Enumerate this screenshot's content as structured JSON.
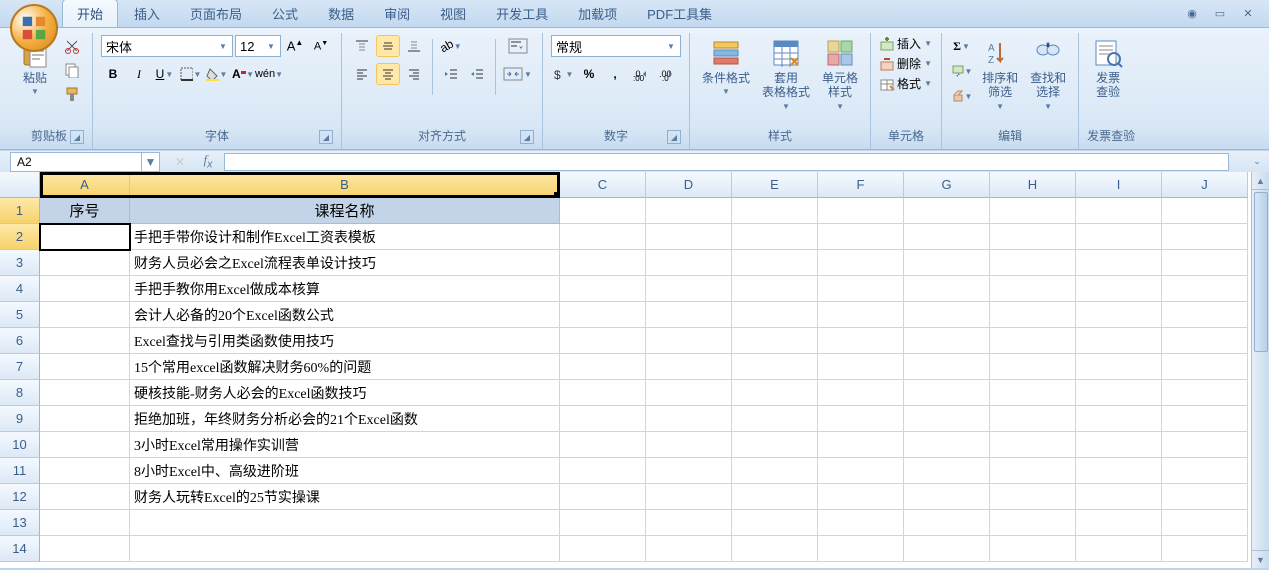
{
  "tabs": [
    "开始",
    "插入",
    "页面布局",
    "公式",
    "数据",
    "审阅",
    "视图",
    "开发工具",
    "加载项",
    "PDF工具集"
  ],
  "active_tab": 0,
  "ribbon": {
    "clipboard": {
      "paste": "粘贴",
      "label": "剪贴板"
    },
    "font": {
      "name": "宋体",
      "size": "12",
      "label": "字体"
    },
    "align": {
      "label": "对齐方式"
    },
    "number": {
      "format": "常规",
      "label": "数字"
    },
    "styles": {
      "cond": "条件格式",
      "table": "套用\n表格格式",
      "cell": "单元格\n样式",
      "label": "样式"
    },
    "cells": {
      "insert": "插入",
      "delete": "删除",
      "format": "格式",
      "label": "单元格"
    },
    "editing": {
      "sort": "排序和\n筛选",
      "find": "查找和\n选择",
      "label": "编辑"
    },
    "invoice": {
      "check": "发票\n查验",
      "label": "发票查验"
    }
  },
  "namebox": "A2",
  "columns": [
    "A",
    "B",
    "C",
    "D",
    "E",
    "F",
    "G",
    "H",
    "I",
    "J"
  ],
  "rows": [
    "1",
    "2",
    "3",
    "4",
    "5",
    "6",
    "7",
    "8",
    "9",
    "10",
    "11",
    "12",
    "13",
    "14"
  ],
  "header_row": {
    "A": "序号",
    "B": "课程名称"
  },
  "data_rows": [
    "手把手带你设计和制作Excel工资表模板",
    "财务人员必会之Excel流程表单设计技巧",
    "手把手教你用Excel做成本核算",
    "会计人必备的20个Excel函数公式",
    "Excel查找与引用类函数使用技巧",
    "15个常用excel函数解决财务60%的问题",
    "硬核技能-财务人必会的Excel函数技巧",
    "拒绝加班，年终财务分析必会的21个Excel函数",
    "3小时Excel常用操作实训营",
    "8小时Excel中、高级进阶班",
    "财务人玩转Excel的25节实操课"
  ],
  "selection": {
    "active": "A2",
    "range": "A1:B1"
  }
}
